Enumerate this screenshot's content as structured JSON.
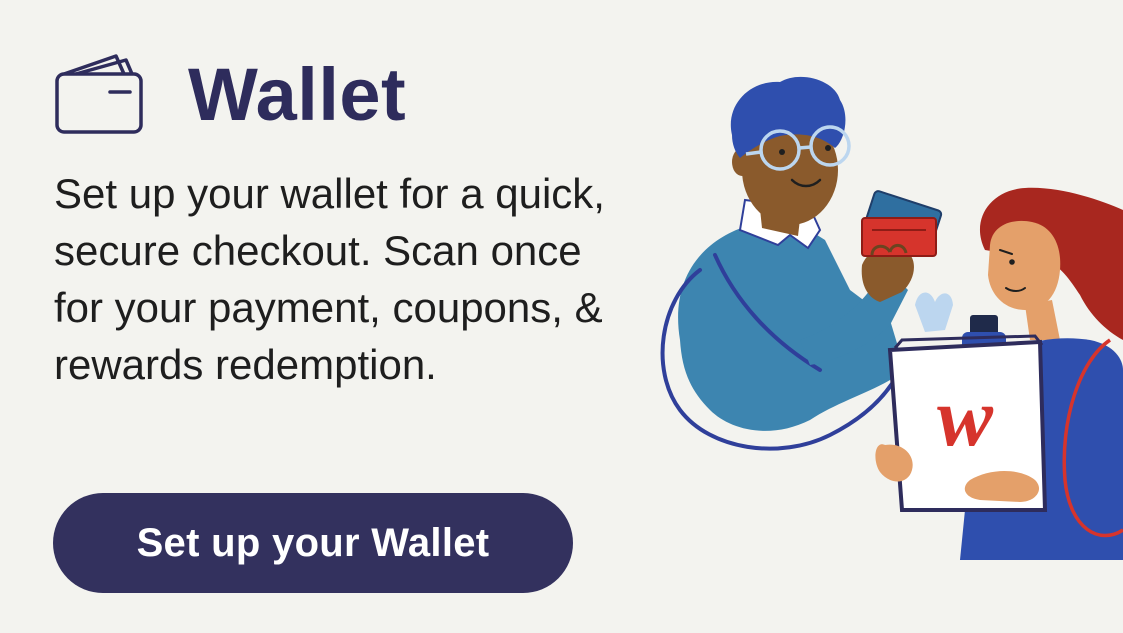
{
  "header": {
    "title": "Wallet",
    "icon": "wallet-icon"
  },
  "body": {
    "description": "Set up your wallet for a quick, secure checkout. Scan once for your payment, coupons, & rewards redemption."
  },
  "cta": {
    "label": "Set up your Wallet"
  },
  "illustration": {
    "bag_logo": "w"
  },
  "colors": {
    "background": "#f3f3ef",
    "brand_navy": "#33315e",
    "title_navy": "#2e2c5c",
    "accent_red": "#d6342c",
    "sweater_blue": "#3d85b0",
    "hair_red": "#a8271f"
  }
}
